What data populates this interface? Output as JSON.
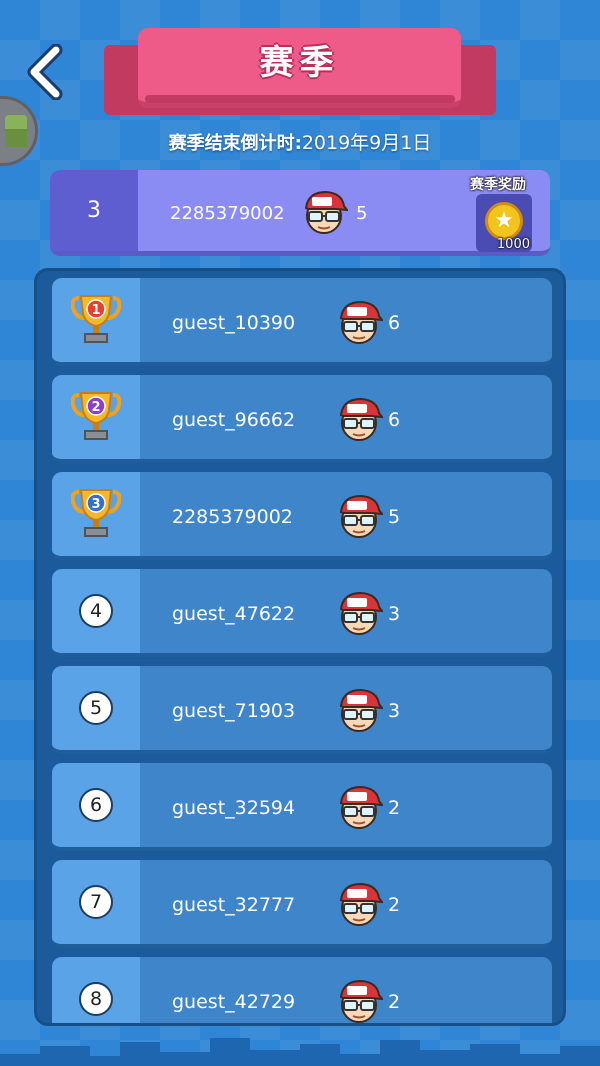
{
  "header": {
    "title": "赛季",
    "countdown_label": "赛季结束倒计时:",
    "countdown_date": "2019年9月1日"
  },
  "my_rank": {
    "rank": "3",
    "user_id": "2285379002",
    "score": "5",
    "reward_label": "赛季奖励",
    "reward_amount": "1000"
  },
  "leaderboard": [
    {
      "rank": "1",
      "name": "guest_10390",
      "score": "6",
      "badge": "trophy-gold-red"
    },
    {
      "rank": "2",
      "name": "guest_96662",
      "score": "6",
      "badge": "trophy-gold-purple"
    },
    {
      "rank": "3",
      "name": "2285379002",
      "score": "5",
      "badge": "trophy-gold-blue"
    },
    {
      "rank": "4",
      "name": "guest_47622",
      "score": "3",
      "badge": "rank-circle"
    },
    {
      "rank": "5",
      "name": "guest_71903",
      "score": "3",
      "badge": "rank-circle"
    },
    {
      "rank": "6",
      "name": "guest_32594",
      "score": "2",
      "badge": "rank-circle"
    },
    {
      "rank": "7",
      "name": "guest_32777",
      "score": "2",
      "badge": "rank-circle"
    },
    {
      "rank": "8",
      "name": "guest_42729",
      "score": "2",
      "badge": "rank-circle"
    }
  ],
  "colors": {
    "background": "#2f86d6",
    "title_pink": "#ef5b88",
    "my_row": "#8b8cf3",
    "row": "#3f85c9",
    "panel": "#1b5b9c"
  },
  "icons": {
    "back": "back-arrow-icon",
    "chest": "treasure-chest-icon",
    "avatar": "player-avatar-icon",
    "coin": "coin-icon",
    "trophy": "trophy-icon"
  }
}
